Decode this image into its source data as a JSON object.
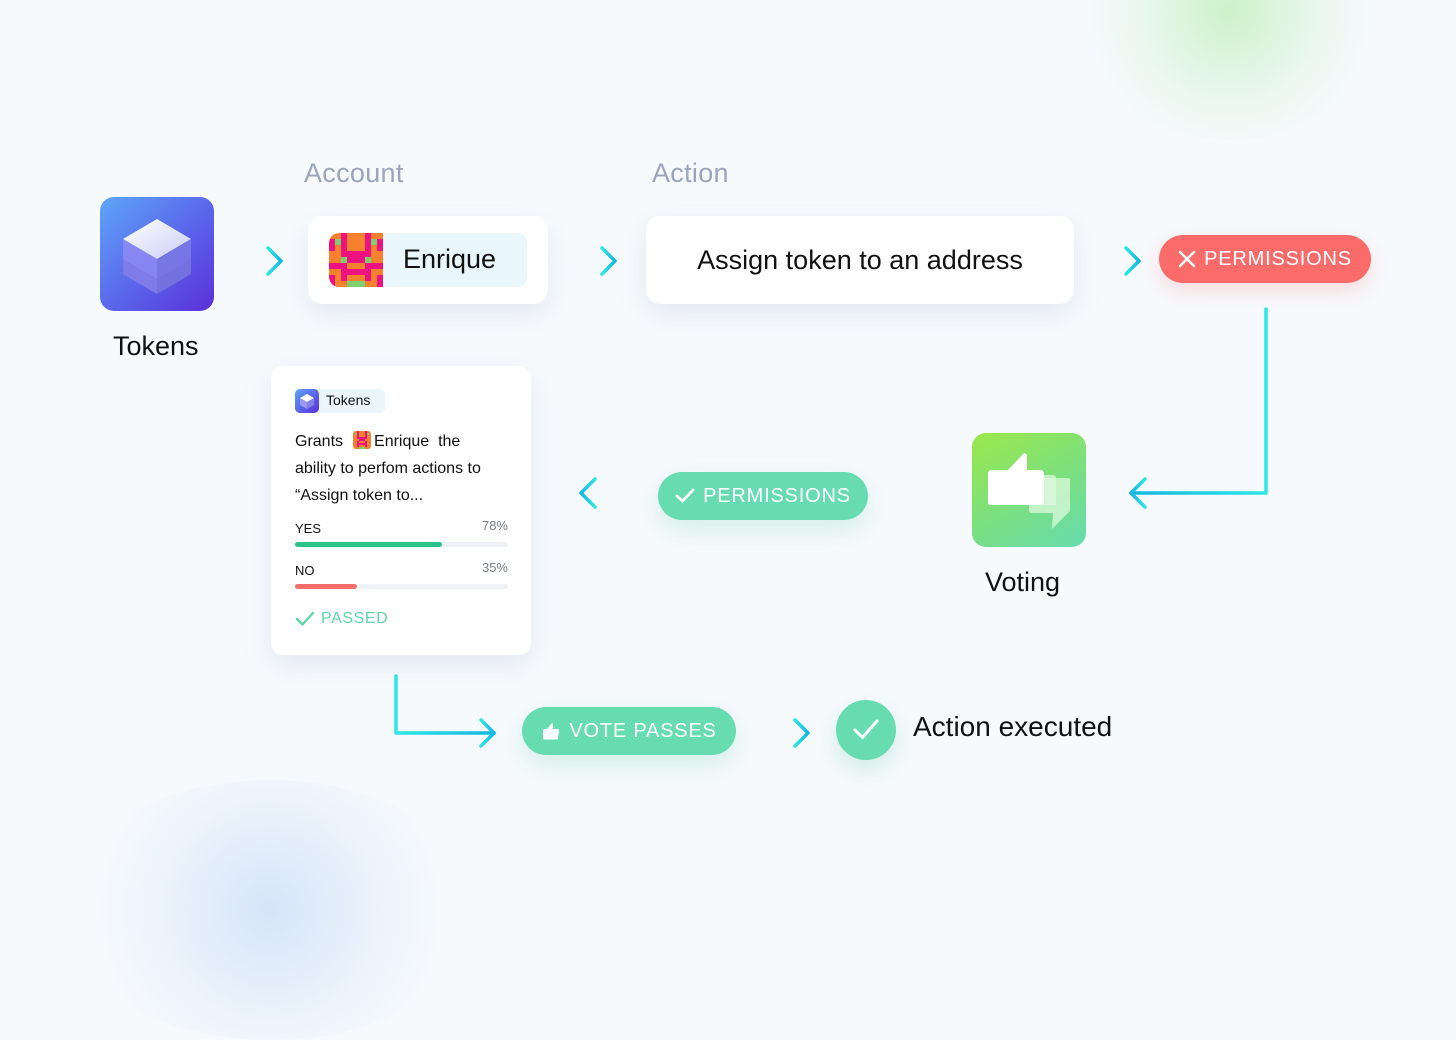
{
  "flow": {
    "source_app": {
      "name": "Tokens",
      "icon": "cube-icon"
    },
    "account": {
      "section_label": "Account",
      "name": "Enrique",
      "avatar": "identicon"
    },
    "action": {
      "section_label": "Action",
      "text": "Assign token to an address"
    },
    "permission_denied": {
      "label": "PERMISSIONS",
      "icon": "x-icon",
      "color": "#fb6b69"
    },
    "voting_app": {
      "name": "Voting",
      "icon": "thumbs-up-down-icon"
    },
    "permission_granted": {
      "label": "PERMISSIONS",
      "icon": "check-icon",
      "color": "#67dcb0"
    },
    "vote_passes": {
      "label": "VOTE PASSES",
      "icon": "thumbs-up-icon"
    },
    "action_executed": {
      "label": "Action executed",
      "icon": "check-icon"
    }
  },
  "proposal": {
    "app_tag": "Tokens",
    "text_prefix": "Grants",
    "account_name": "Enrique",
    "text_suffix": "the",
    "text_line2": "ability to perfom actions to",
    "text_line3": "“Assign token to...",
    "votes": [
      {
        "label": "YES",
        "percent_text": "78%",
        "fill_fraction": 0.69,
        "color": "#2cc38a"
      },
      {
        "label": "NO",
        "percent_text": "35%",
        "fill_fraction": 0.29,
        "color": "#f56e6c"
      }
    ],
    "status": "PASSED"
  },
  "colors": {
    "arrow": "#1fc6e0",
    "accent_green": "#67dcb0",
    "accent_red": "#fb6b69"
  }
}
